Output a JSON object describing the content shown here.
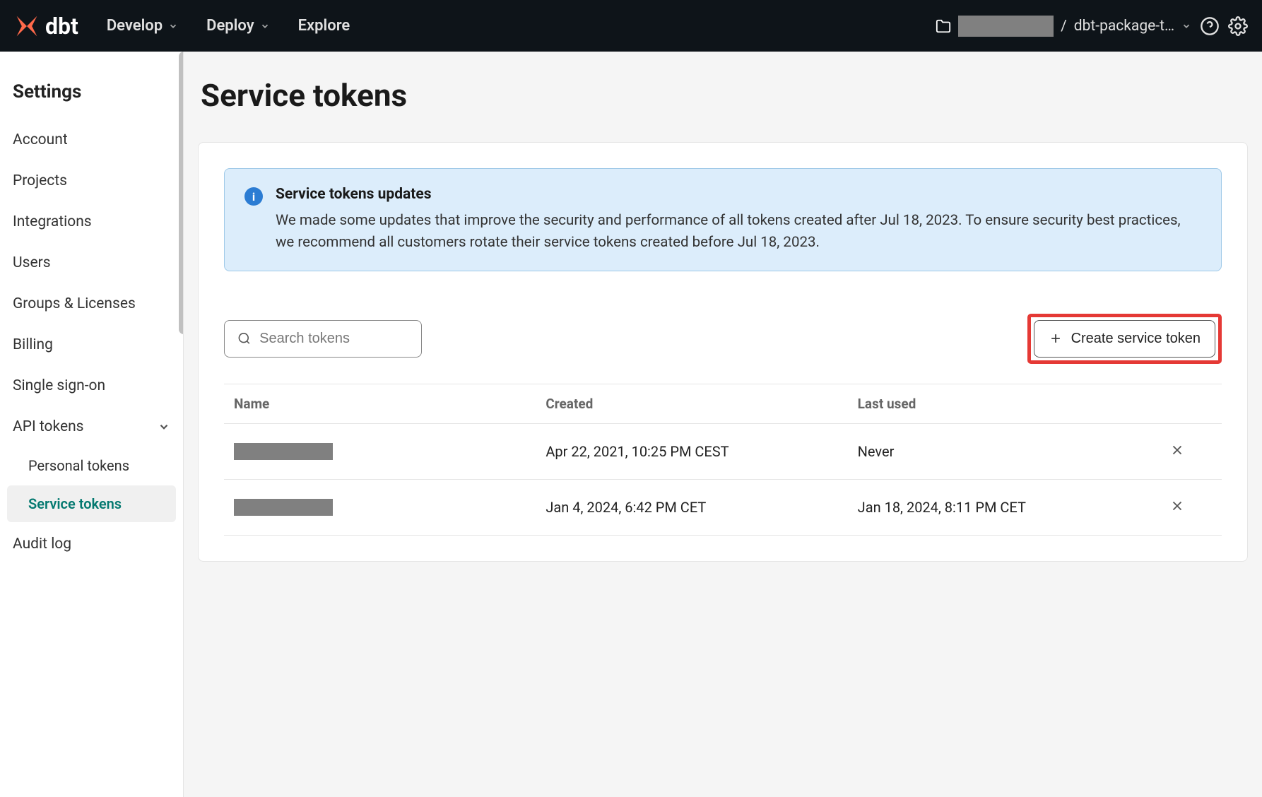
{
  "topbar": {
    "logo_text": "dbt",
    "nav": {
      "develop": "Develop",
      "deploy": "Deploy",
      "explore": "Explore"
    },
    "project_separator": "/",
    "project_name": "dbt-package-t…"
  },
  "sidebar": {
    "heading": "Settings",
    "items": {
      "account": "Account",
      "projects": "Projects",
      "integrations": "Integrations",
      "users": "Users",
      "groups_licenses": "Groups & Licenses",
      "billing": "Billing",
      "sso": "Single sign-on",
      "api_tokens": "API tokens",
      "personal_tokens": "Personal tokens",
      "service_tokens": "Service tokens",
      "audit_log": "Audit log"
    }
  },
  "main": {
    "page_title": "Service tokens",
    "info_banner": {
      "title": "Service tokens updates",
      "body": "We made some updates that improve the security and performance of all tokens created after Jul 18, 2023. To ensure security best practices, we recommend all customers rotate their service tokens created before Jul 18, 2023."
    },
    "search_placeholder": "Search tokens",
    "create_button": "Create service token",
    "table": {
      "headers": {
        "name": "Name",
        "created": "Created",
        "last_used": "Last used"
      },
      "rows": [
        {
          "created": "Apr 22, 2021, 10:25 PM CEST",
          "last_used": "Never"
        },
        {
          "created": "Jan 4, 2024, 6:42 PM CET",
          "last_used": "Jan 18, 2024, 8:11 PM CET"
        }
      ]
    }
  }
}
